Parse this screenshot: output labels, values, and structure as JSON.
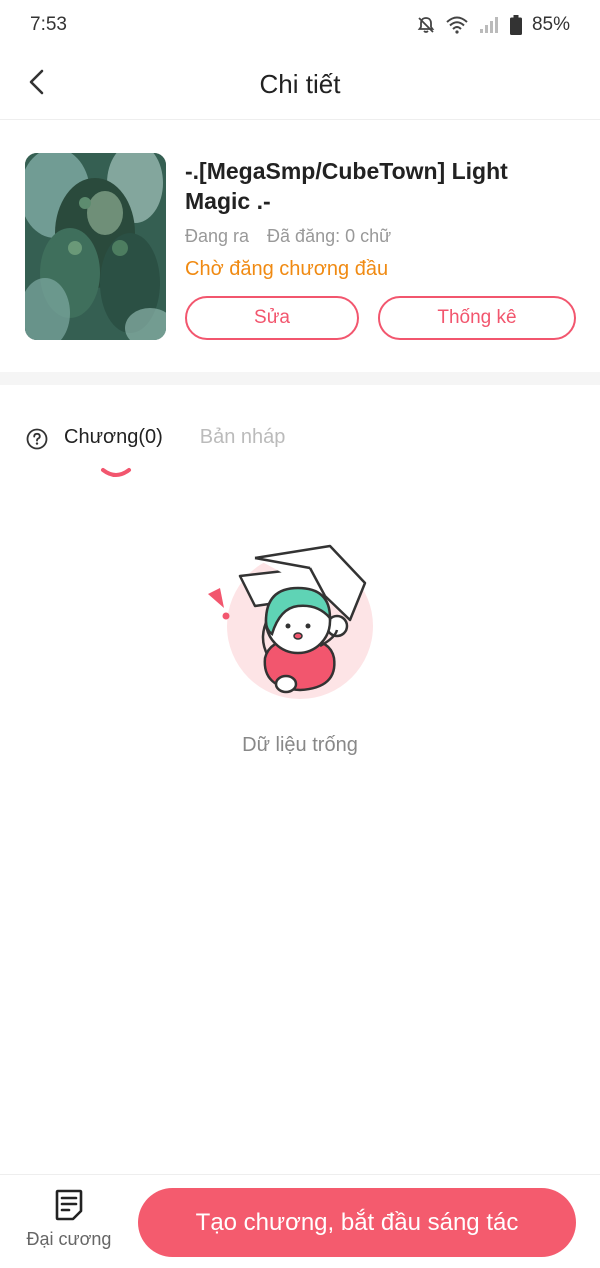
{
  "status_bar": {
    "time": "7:53",
    "battery": "85%",
    "icons": [
      "bell-off-icon",
      "wifi-icon",
      "signal-icon",
      "battery-icon"
    ]
  },
  "header": {
    "title": "Chi tiết",
    "back_icon": "chevron-left-icon"
  },
  "book": {
    "title": "-.[MegaSmp/CubeTown] Light Magic .-",
    "state": "Đang ra",
    "word_count": "Đã đăng: 0 chữ",
    "publish_status": "Chờ đăng chương đầu",
    "edit_label": "Sửa",
    "stats_label": "Thống kê"
  },
  "tabs": {
    "help_icon": "question-circle-icon",
    "items": [
      {
        "label": "Chương(0)",
        "active": true
      },
      {
        "label": "Bản nháp",
        "active": false
      }
    ]
  },
  "empty_state": {
    "text": "Dữ liệu trống"
  },
  "bottom_bar": {
    "outline_label": "Đại cương",
    "outline_icon": "document-list-icon",
    "cta_label": "Tạo chương, bắt đầu sáng tác"
  },
  "colors": {
    "accent": "#f2566e",
    "cta": "#f45b6e",
    "status_orange": "#f08a12"
  }
}
